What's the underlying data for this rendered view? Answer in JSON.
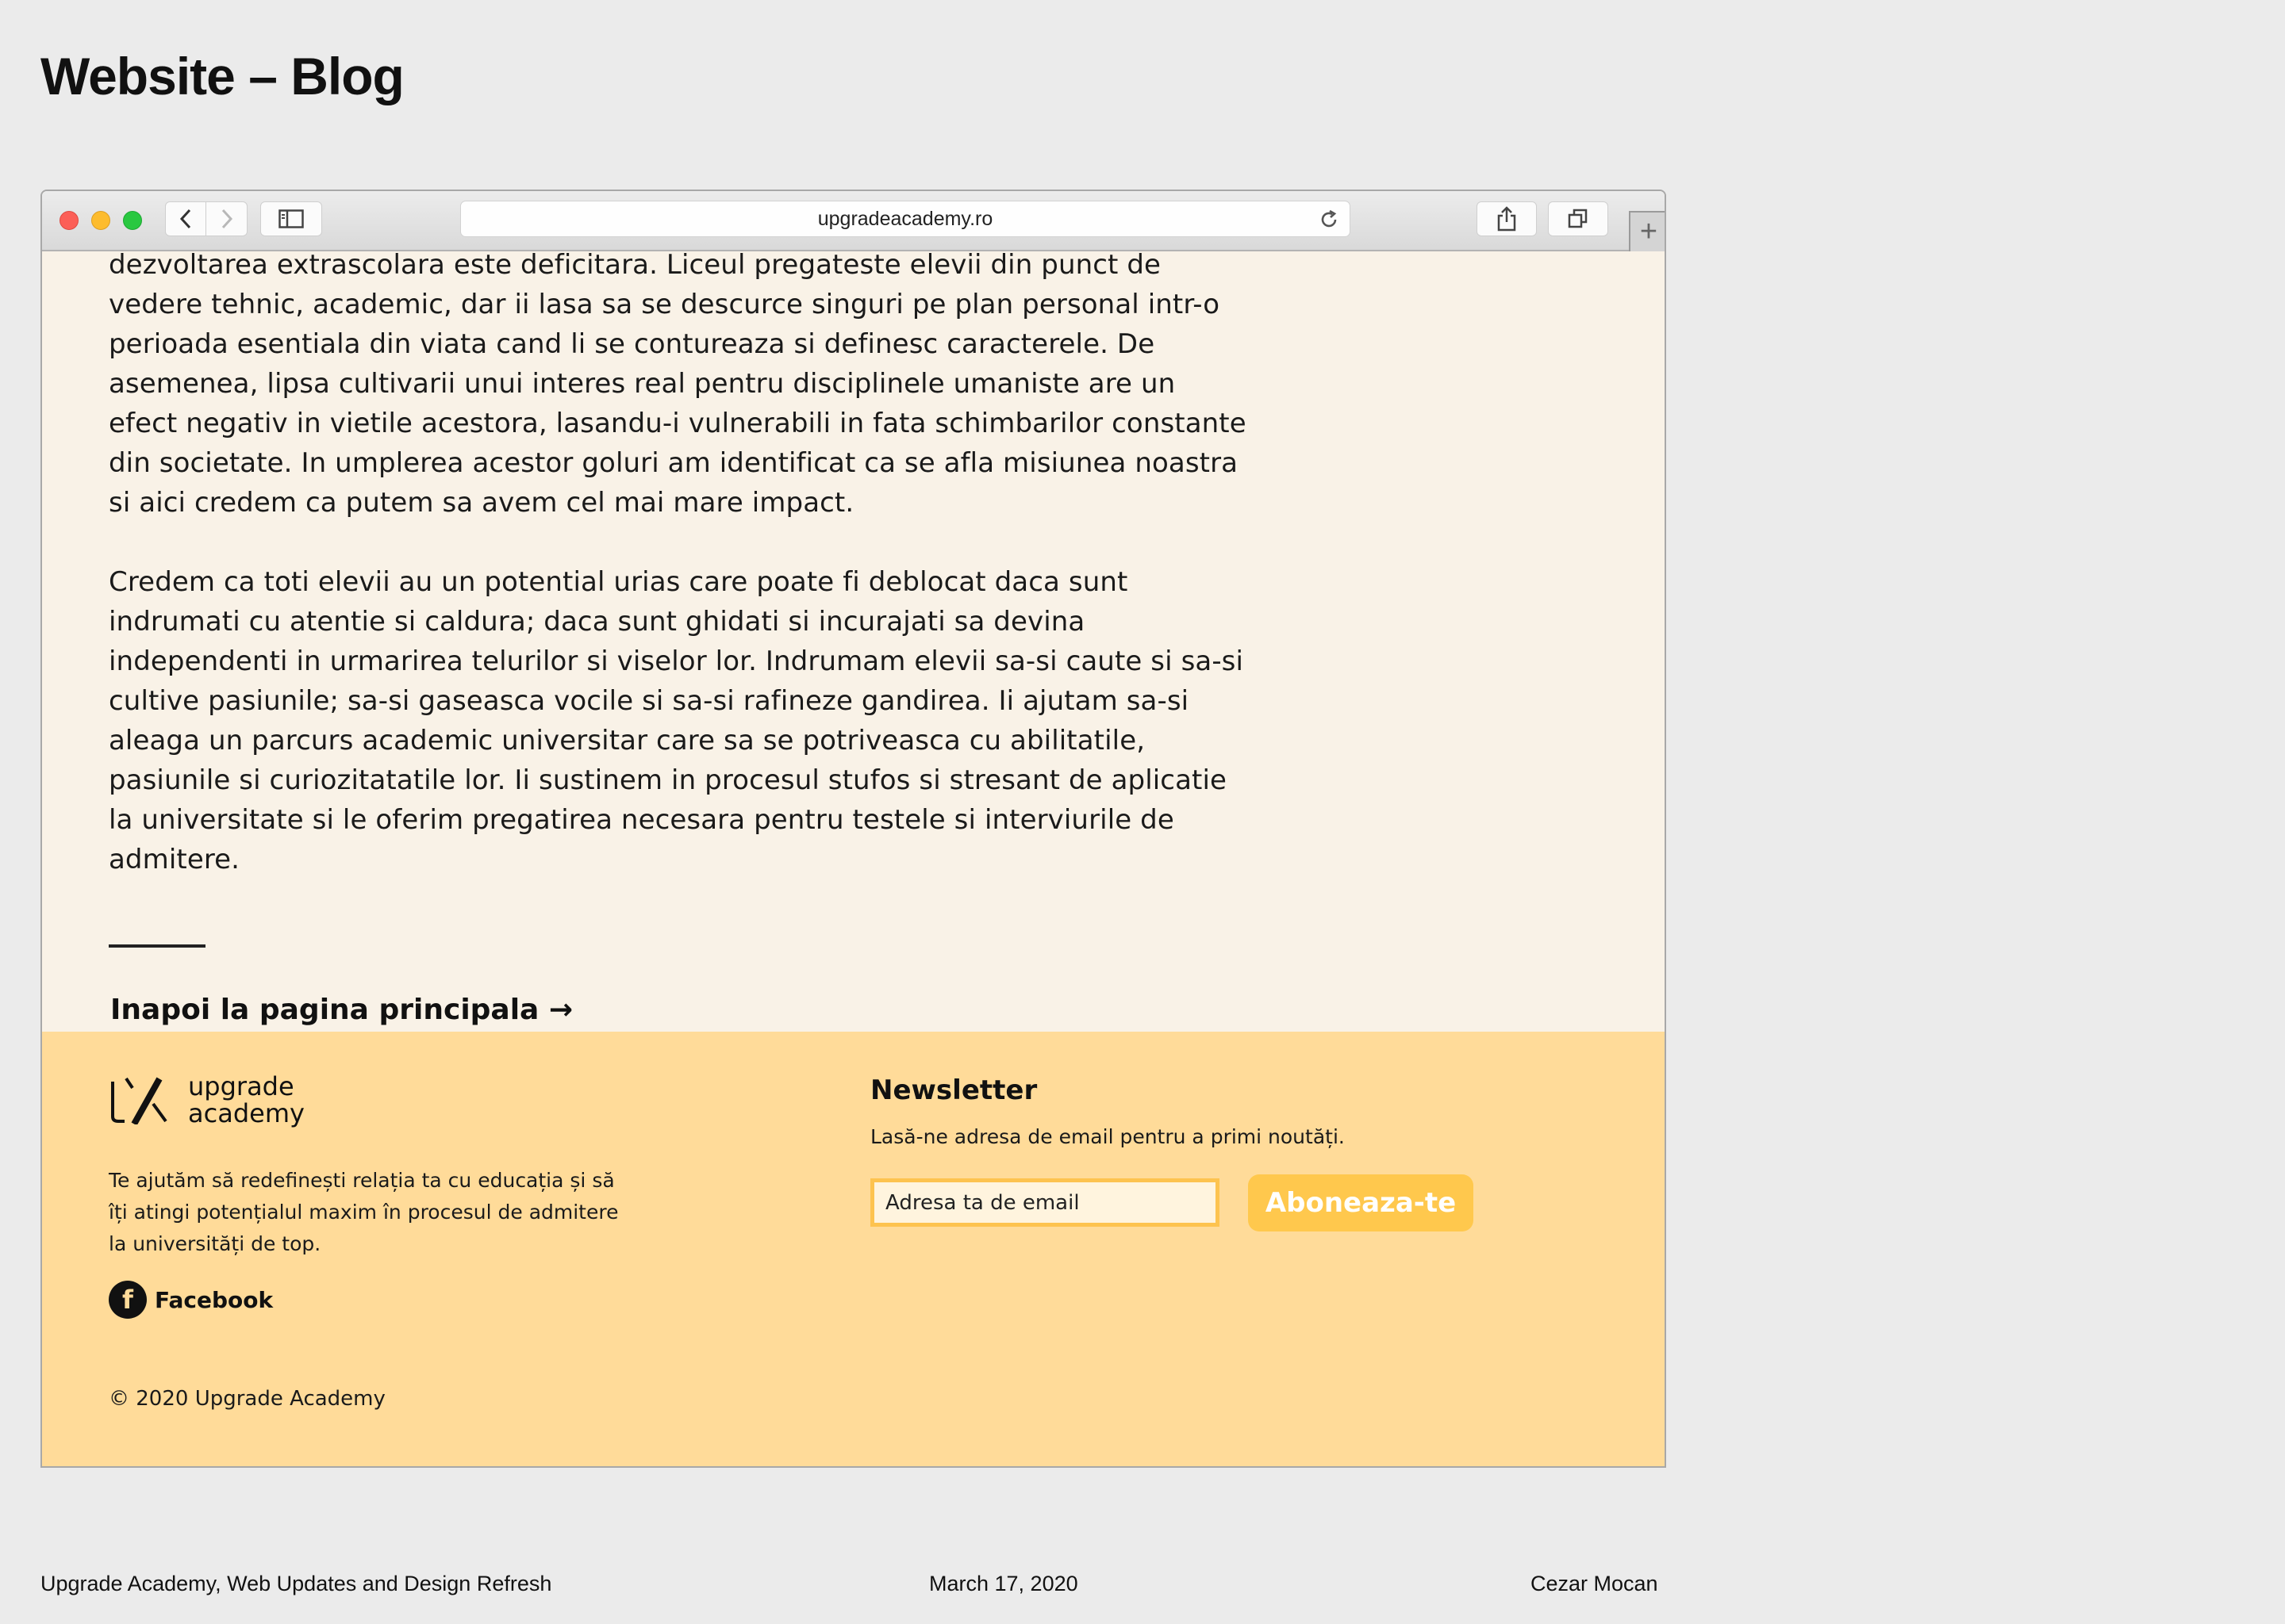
{
  "slide": {
    "title": "Website – Blog",
    "footer_left": "Upgrade Academy, Web Updates and Design Refresh",
    "footer_center": "March 17, 2020",
    "footer_right": "Cezar Mocan"
  },
  "browser": {
    "url": "upgradeacademy.ro",
    "icons": {
      "back": "chevron-left-icon",
      "forward": "chevron-right-icon",
      "sidebar": "sidebar-icon",
      "reload": "reload-icon",
      "share": "share-icon",
      "tabs": "tabs-icon",
      "new_tab": "plus-icon"
    },
    "new_tab_glyph": "+"
  },
  "article": {
    "paragraph_1": "dezvoltarea extrascolara este deficitara. Liceul pregateste elevii din punct de vedere tehnic, academic, dar ii lasa sa se descurce singuri pe plan personal intr-o perioada esentiala din viata cand li se contureaza si definesc caracterele. De asemenea, lipsa cultivarii unui interes real pentru disciplinele umaniste are un efect negativ in vietile acestora, lasandu-i vulnerabili in fata schimbarilor constante din societate. In umplerea acestor goluri am identificat ca se afla misiunea noastra si aici credem ca putem sa avem cel mai mare impact.",
    "paragraph_2": "Credem ca toti elevii au un potential urias care poate fi deblocat daca sunt indrumati cu atentie si caldura; daca sunt ghidati si incurajati sa devina independenti in urmarirea telurilor si viselor lor. Indrumam elevii sa-si caute si sa-si cultive pasiunile; sa-si gaseasca vocile si sa-si rafineze gandirea. Ii ajutam sa-si aleaga un parcurs academic universitar care sa se potriveasca cu abilitatile, pasiunile si curiozitatatile lor. Ii sustinem in procesul stufos si stresant de aplicatie la universitate si le oferim pregatirea necesara pentru testele si interviurile de admitere.",
    "back_link": "Inapoi la pagina principala →"
  },
  "footer": {
    "logo_line1": "upgrade",
    "logo_line2": "academy",
    "tagline": "Te ajutăm să redefinești relația ta cu educația și să îți atingi potențialul maxim în procesul de admitere la universități de top.",
    "facebook_label": "Facebook",
    "facebook_glyph": "f",
    "copyright": "© 2020 Upgrade Academy",
    "newsletter_title": "Newsletter",
    "newsletter_desc": "Lasă-ne adresa de email pentru a primi noutăți.",
    "email_placeholder": "Adresa ta de email",
    "subscribe_label": "Aboneaza-te"
  },
  "colors": {
    "page_bg": "#ebebeb",
    "content_bg": "#f9f2e7",
    "footer_bg": "#ffdb99",
    "accent": "#ffc84d"
  }
}
